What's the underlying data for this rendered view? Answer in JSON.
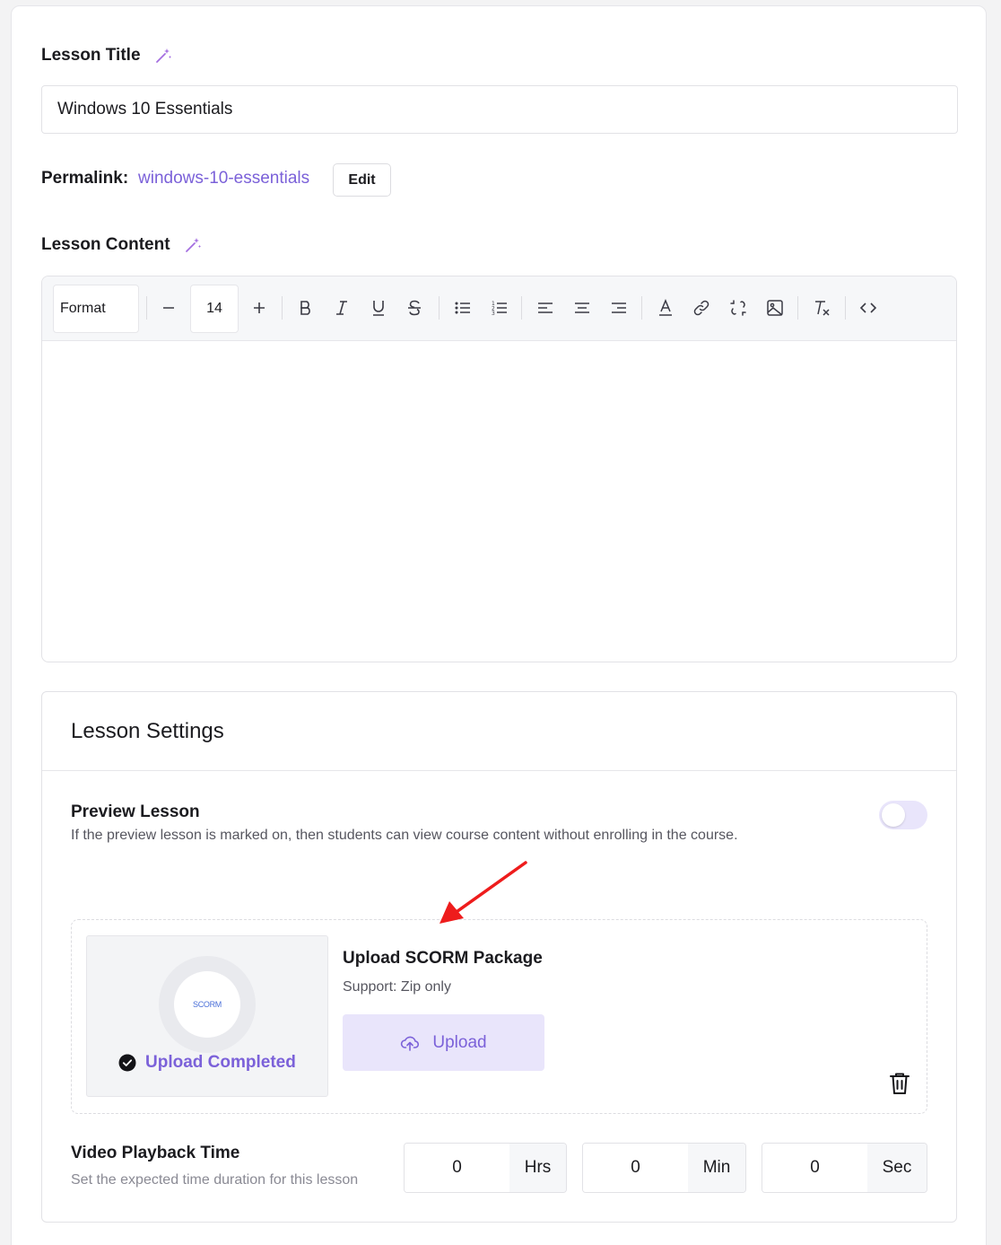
{
  "lesson_title": {
    "label": "Lesson Title",
    "value": "Windows 10 Essentials"
  },
  "permalink": {
    "label": "Permalink:",
    "value": "windows-10-essentials",
    "edit_label": "Edit"
  },
  "lesson_content": {
    "label": "Lesson Content",
    "toolbar": {
      "format_label": "Format",
      "font_size": "14",
      "buttons": [
        "decrease-size",
        "increase-size",
        "bold",
        "italic",
        "underline",
        "strikethrough",
        "bullet-list",
        "numbered-list",
        "align-left",
        "align-center",
        "align-right",
        "text-color",
        "link",
        "unlink",
        "image",
        "clear-format",
        "code"
      ]
    },
    "body": ""
  },
  "settings": {
    "title": "Lesson Settings",
    "preview": {
      "title": "Preview Lesson",
      "description": "If the preview lesson is marked on, then students can view course content without enrolling in the course.",
      "enabled": false
    },
    "scorm": {
      "thumb_text": "SCORM",
      "status": "Upload Completed",
      "title": "Upload SCORM Package",
      "support": "Support: Zip only",
      "upload_label": "Upload"
    },
    "video_playback": {
      "title": "Video Playback Time",
      "description": "Set the expected time duration for this lesson",
      "hours": "0",
      "hours_unit": "Hrs",
      "minutes": "0",
      "minutes_unit": "Min",
      "seconds": "0",
      "seconds_unit": "Sec"
    }
  },
  "colors": {
    "accent": "#7b61d9",
    "accent_soft": "#e9e5fb",
    "annotation_arrow": "#ee1c1c"
  }
}
